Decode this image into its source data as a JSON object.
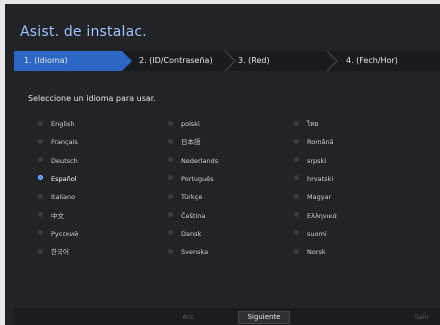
{
  "title": "Asist. de instalac.",
  "steps": [
    {
      "label": "1.  (Idioma)",
      "active": true
    },
    {
      "label": "2.  (ID/Contraseña)",
      "active": false
    },
    {
      "label": "3.  (Red)",
      "active": false
    },
    {
      "label": "4.  (Fech/Hor)",
      "active": false
    }
  ],
  "prompt": "Seleccione un idioma para usar.",
  "languages": [
    [
      "English",
      "polski",
      "ไทย"
    ],
    [
      "Français",
      "日本語",
      "Română"
    ],
    [
      "Deutsch",
      "Nederlands",
      "srpski"
    ],
    [
      "Español",
      "Português",
      "hrvatski"
    ],
    [
      "Italiano",
      "Türkçe",
      "Magyar"
    ],
    [
      "中文",
      "Čeština",
      "Ελληνικά"
    ],
    [
      "Русский",
      "Dansk",
      "suomi"
    ],
    [
      "한국어",
      "Svenska",
      "Norsk"
    ]
  ],
  "selected_language": "Español",
  "buttons": {
    "prev": "Ant.",
    "next": "Siguiente",
    "exit": "Salir"
  },
  "colors": {
    "accent": "#2c67c8",
    "title": "#9ec3ff",
    "background": "#222326"
  }
}
